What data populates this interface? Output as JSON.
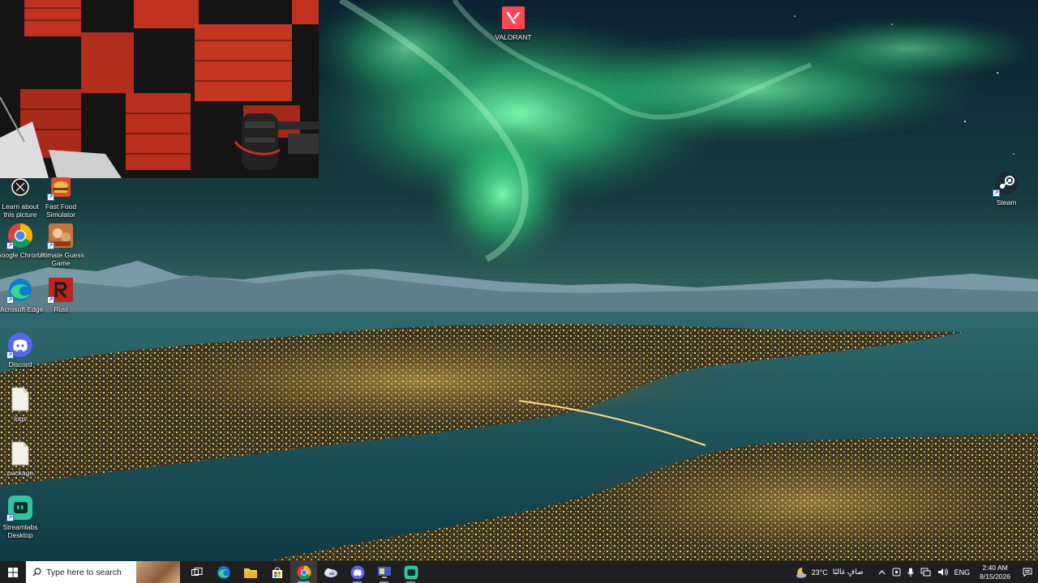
{
  "desktop": {
    "icons": [
      {
        "label": "Learn about this picture"
      },
      {
        "label": "Fast Food Simulator"
      },
      {
        "label": "Google Chrome"
      },
      {
        "label": "Ultimate Guess Game"
      },
      {
        "label": "Microsoft Edge"
      },
      {
        "label": "Rust"
      },
      {
        "label": "Discord"
      },
      {
        "label": "logs"
      },
      {
        "label": "package"
      },
      {
        "label": "Streamlabs Desktop"
      },
      {
        "label": "VALORANT"
      },
      {
        "label": "Steam"
      }
    ]
  },
  "taskbar": {
    "search_placeholder": "Type here to search",
    "apps": [
      "task-view",
      "microsoft-edge",
      "file-explorer",
      "microsoft-store",
      "google-chrome",
      "app-cloud",
      "discord-app",
      "app-screen",
      "streamlabs"
    ],
    "active_app": "google-chrome",
    "weather_temp": "23°C",
    "weather_text": "صافٍ غالبًا",
    "language": "ENG",
    "time": "2:40 AM",
    "date": "8/15/2026"
  },
  "colors": {
    "taskbar_bg": "#1f1f1f",
    "aurora": "#3cf08a",
    "accent": "#7ab8ff"
  }
}
